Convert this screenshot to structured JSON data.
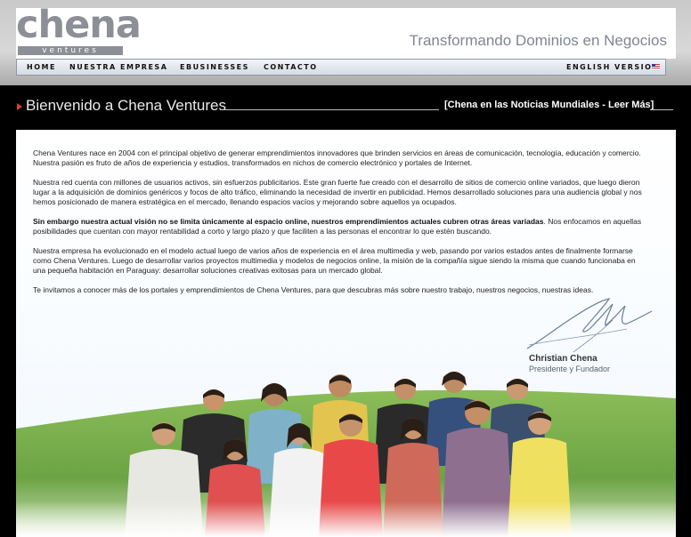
{
  "header": {
    "logo_main": "chena",
    "logo_sub": "ventures",
    "tagline": "Transformando Dominios en Negocios"
  },
  "nav": {
    "items": [
      "HOME",
      "NUESTRA EMPRESA",
      "EBUSINESSES",
      "CONTACTO"
    ],
    "language": "ENGLISH VERSION",
    "language_icon": "us-flag-icon"
  },
  "welcome": {
    "title": "Bienvenido a Chena Ventures",
    "news_link": "[Chena en las Noticias Mundiales - Leer Más]",
    "accent_color": "#d9432a"
  },
  "content": {
    "p1": "Chena Ventures nace en 2004 con el principal objetivo de generar emprendimientos innovadores que brinden servicios en áreas de comunicación, tecnología, educación y comercio. Nuestra pasión es fruto de años de experiencia y estudios, transformados en nichos de comercio electrónico y portales de Internet.",
    "p2": "Nuestra red cuenta con millones de usuarios activos, sin esfuerzos publicitarios. Este gran fuerte fue creado con el desarrollo de sitios de comercio online variados, que luego dieron lugar a la adquisición de dominios genéricos y focos de alto tráfico, eliminando la necesidad de invertir en publicidad. Hemos desarrollado soluciones para una audiencia global y nos hemos posicionado de manera estratégica en el mercado, llenando espacios vacíos y mejorando sobre aquellos ya ocupados.",
    "p3_bold": "Sin embargo nuestra actual visión no se limita únicamente al espacio online, nuestros emprendimientos actuales cubren otras áreas variadas",
    "p3_rest": ". Nos enfocamos en aquellas posibilidades que cuentan con mayor rentabilidad a corto y largo plazo y que faciliten a las personas el encontrar lo que estén buscando.",
    "p4": "Nuestra empresa ha evolucionado en el modelo actual luego de varios años de experiencia en el área multimedia y web, pasando por varios estados antes de finalmente formarse como Chena Ventures. Luego de desarrollar varios proyectos multimedia y modelos de negocios online, la misión de la compañía sigue siendo la misma que cuando funcionaba en una pequeña habitación en Paraguay: desarrollar soluciones creativas exitosas para un mercado global.",
    "p5": "Te invitamos a conocer más de los portales y emprendimientos de Chena Ventures, para que descubras más sobre nuestro trabajo, nuestros negocios, nuestras ideas."
  },
  "signature": {
    "name": "Christian Chena",
    "role": "Presidente y Fundador"
  }
}
